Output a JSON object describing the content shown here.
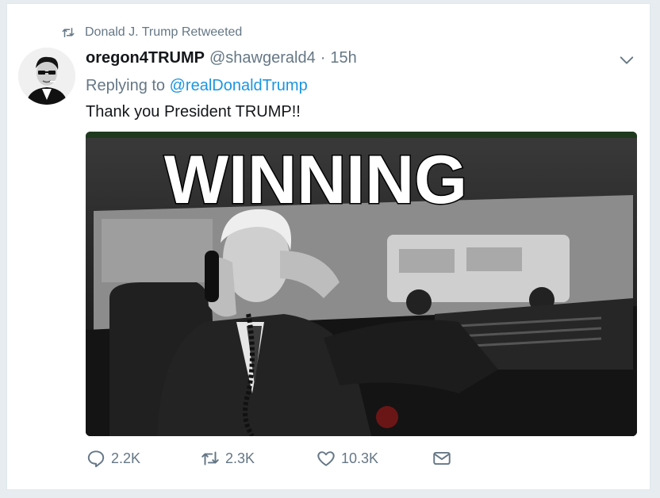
{
  "retweet_context": {
    "text": "Donald J. Trump Retweeted",
    "icon": "retweet-icon"
  },
  "tweet": {
    "display_name": "oregon4TRUMP",
    "handle": "@shawgerald4",
    "separator": "·",
    "time": "15h",
    "replying_prefix": "Replying to",
    "replying_to": "@realDonaldTrump",
    "text": "Thank you President TRUMP!!"
  },
  "media": {
    "caption_text": "WINNING"
  },
  "actions": {
    "reply_count": "2.2K",
    "retweet_count": "2.3K",
    "like_count": "10.3K"
  },
  "colors": {
    "link": "#1b95e0",
    "muted": "#657786",
    "text": "#14171a",
    "background": "#e6ecf0"
  }
}
